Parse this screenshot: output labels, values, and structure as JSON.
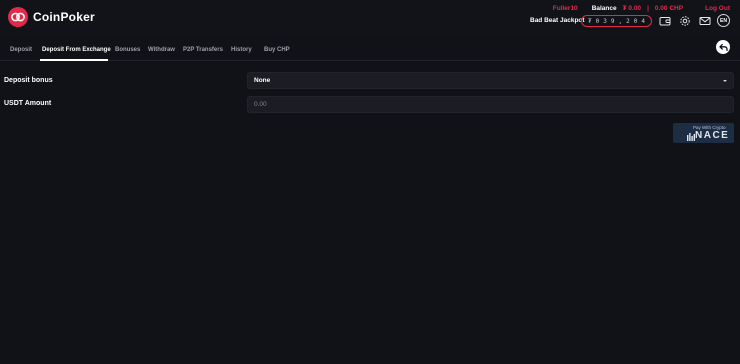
{
  "brand": {
    "name": "CoinPoker",
    "accent": "#e2294a"
  },
  "header": {
    "username": "Fuller10",
    "balance_label": "Balance",
    "balance_usdt": "₮ 0.00",
    "separator": "|",
    "balance_chp": "0.00 CHP",
    "logout": "Log Out",
    "jackpot_label": "Bad Beat Jackpot",
    "jackpot_digits": [
      "₮",
      "0",
      "3",
      "9",
      ",",
      "2",
      "0",
      "4"
    ],
    "language": "EN",
    "icons": [
      "wallet-icon",
      "gear-icon",
      "mail-icon"
    ]
  },
  "tabs": [
    {
      "label": "Deposit",
      "active": false
    },
    {
      "label": "Deposit From Exchange",
      "active": true
    },
    {
      "label": "Bonuses",
      "active": false
    },
    {
      "label": "Withdraw",
      "active": false
    },
    {
      "label": "P2P Transfers",
      "active": false
    },
    {
      "label": "History",
      "active": false
    },
    {
      "label": "Buy CHP",
      "active": false
    }
  ],
  "form": {
    "deposit_bonus_label": "Deposit bonus",
    "deposit_bonus_value": "None",
    "usdt_amount_label": "USDT Amount",
    "usdt_amount_placeholder": "0.00"
  },
  "nace": {
    "pay_with": "Pay With Crypto",
    "name": "NACE"
  }
}
